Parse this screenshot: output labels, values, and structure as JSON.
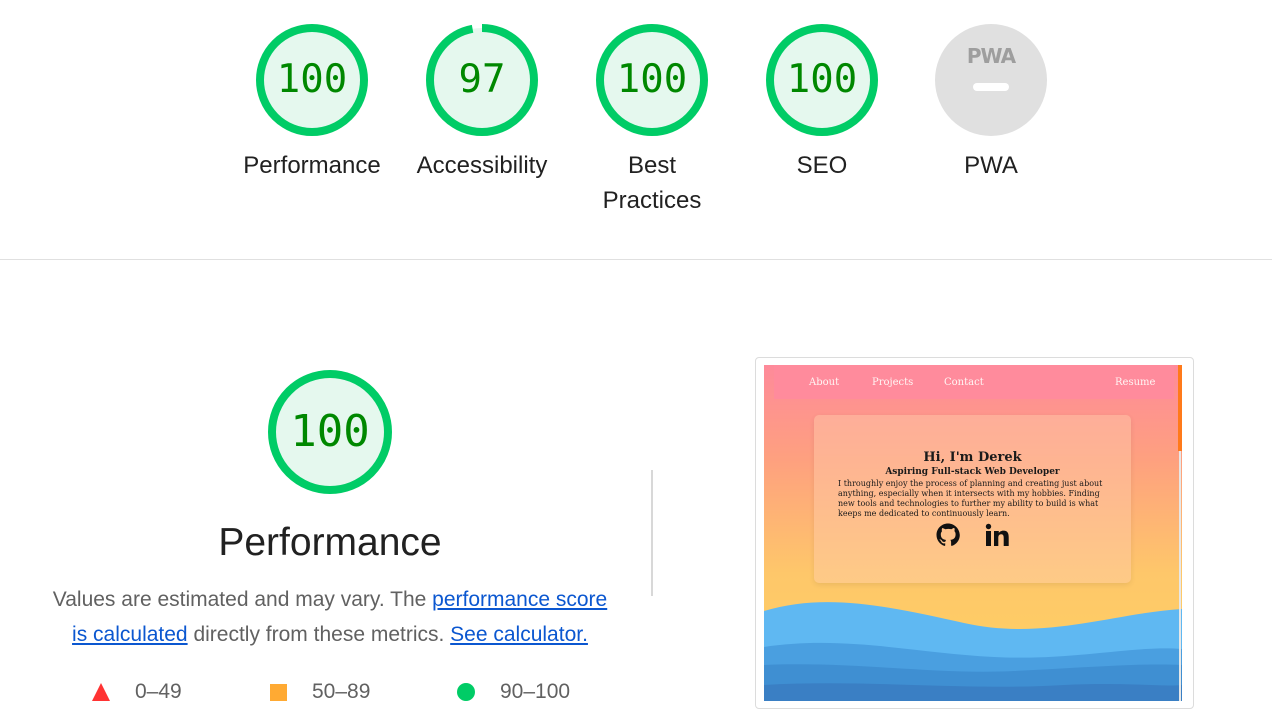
{
  "gauges": [
    {
      "score": "100",
      "label": "Performance",
      "value": 100
    },
    {
      "score": "97",
      "label": "Accessibility",
      "value": 97
    },
    {
      "score": "100",
      "label": "Best Practices",
      "value": 100
    },
    {
      "score": "100",
      "label": "SEO",
      "value": 100
    },
    {
      "score": "",
      "label": "PWA",
      "logo": "PWA"
    }
  ],
  "performance": {
    "score": "100",
    "title": "Performance",
    "desc_prefix": "Values are estimated and may vary. The ",
    "link_score": "performance score is calculated",
    "desc_mid": " directly from these metrics. ",
    "link_calc": "See calculator."
  },
  "legend": [
    {
      "icon": "red-triangle-icon",
      "label": "0–49"
    },
    {
      "icon": "orange-square-icon",
      "label": "50–89"
    },
    {
      "icon": "green-circle-icon",
      "label": "90–100"
    }
  ],
  "screenshot": {
    "nav": [
      "About",
      "Projects",
      "Contact",
      "Resume"
    ],
    "heading": "Hi, I'm Derek",
    "subheading": "Aspiring Full-stack Web Developer",
    "body": "I throughly enjoy the process of planning and creating just about anything, especially when it intersects with my hobbies. Finding new tools and technologies to further my ability to build is what keeps me dedicated to continuously learn.",
    "icons": [
      "github-icon",
      "linkedin-icon"
    ]
  },
  "colors": {
    "pass": "#00cc66",
    "pass_fill": "#e5f8ee",
    "pass_text": "#008800",
    "na": "#e0e0e0",
    "link": "#0b57d0"
  }
}
